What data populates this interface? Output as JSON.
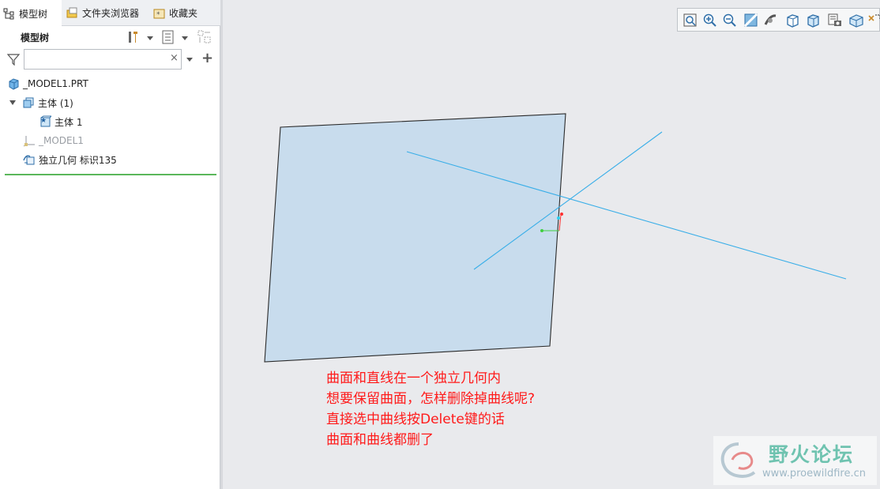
{
  "tabs": [
    {
      "label": "模型树",
      "icon": "model-tree-icon",
      "active": true
    },
    {
      "label": "文件夹浏览器",
      "icon": "folder-browser-icon",
      "active": false
    },
    {
      "label": "收藏夹",
      "icon": "favorites-icon",
      "active": false
    }
  ],
  "panel": {
    "title": "模型树",
    "tools": [
      "settings-icon",
      "show-icon",
      "tree-filter-icon"
    ]
  },
  "search": {
    "value": "",
    "placeholder": ""
  },
  "tree": [
    {
      "label": "_MODEL1.PRT",
      "icon": "part-icon",
      "dim": false
    },
    {
      "label": "主体 (1)",
      "icon": "bodies-icon",
      "dim": false,
      "expanded": true
    },
    {
      "label": "主体 1",
      "icon": "body-icon",
      "dim": false
    },
    {
      "label": "_MODEL1",
      "icon": "coordinate-system-icon",
      "dim": true
    },
    {
      "label": "独立几何 标识135",
      "icon": "independent-geometry-icon",
      "dim": false
    }
  ],
  "toolbar": [
    "refit-icon",
    "zoom-in-icon",
    "zoom-out-icon",
    "repaint-icon",
    "spin-center-icon",
    "display-style-icon",
    "saved-orientations-icon",
    "view-manager-icon",
    "perspective-icon",
    "datum-display-icon"
  ],
  "note": [
    "曲面和直线在一个独立几何内",
    "想要保留曲面，怎样删除掉曲线呢?",
    "直接选中曲线按Delete键的话",
    "曲面和曲线都删了"
  ],
  "watermark": {
    "name": "野火论坛",
    "url": "www.proewildfire.cn"
  },
  "colors": {
    "surface_fill": "#c8dced",
    "curve": "#39aee8",
    "note": "#ff1a1a"
  }
}
